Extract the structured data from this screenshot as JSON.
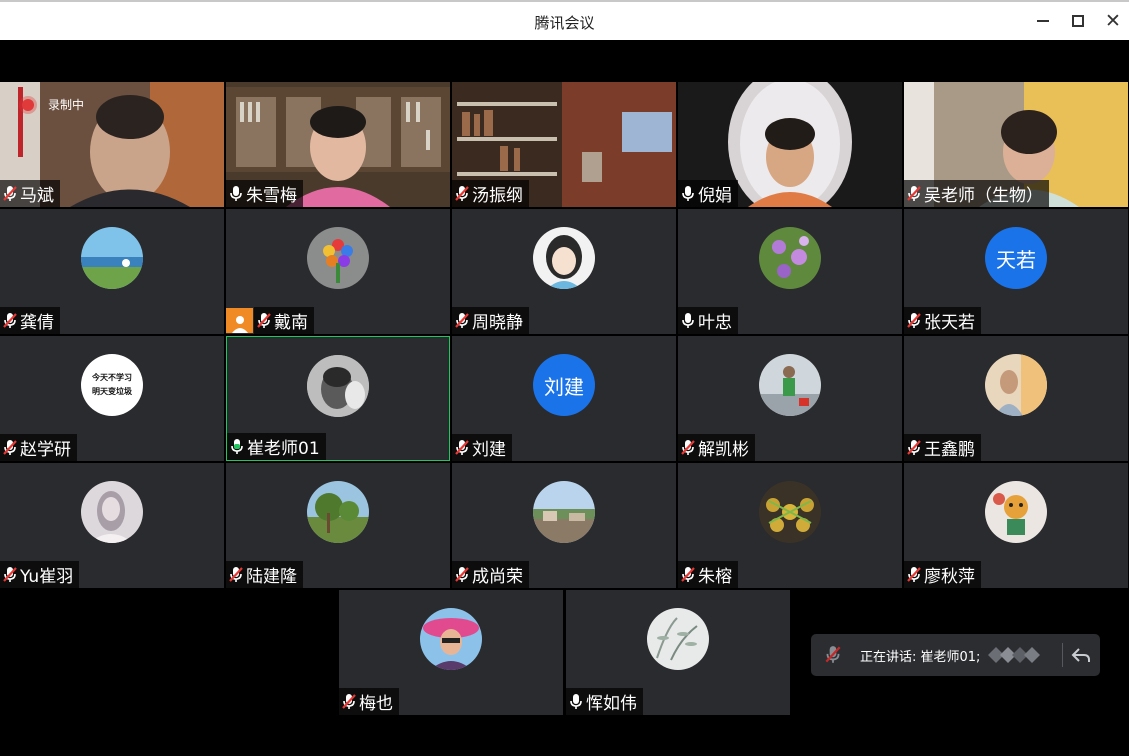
{
  "window": {
    "title": "腾讯会议"
  },
  "recording": {
    "label": "录制中"
  },
  "participants": [
    {
      "name": "马斌",
      "mic": "muted"
    },
    {
      "name": "朱雪梅",
      "mic": "on"
    },
    {
      "name": "汤振纲",
      "mic": "muted"
    },
    {
      "name": "倪娟",
      "mic": "on"
    },
    {
      "name": "吴老师（生物）",
      "mic": "muted"
    },
    {
      "name": "龚倩",
      "mic": "muted"
    },
    {
      "name": "戴南",
      "mic": "muted"
    },
    {
      "name": "周晓静",
      "mic": "muted"
    },
    {
      "name": "叶忠",
      "mic": "on"
    },
    {
      "name": "张天若",
      "mic": "muted",
      "avatar_text": "天若"
    },
    {
      "name": "赵学研",
      "mic": "muted",
      "avatar_line1": "今天不学习",
      "avatar_line2": "明天变垃圾"
    },
    {
      "name": "崔老师01",
      "mic": "speaking"
    },
    {
      "name": "刘建",
      "mic": "muted",
      "avatar_text": "刘建"
    },
    {
      "name": "解凯彬",
      "mic": "muted"
    },
    {
      "name": "王鑫鹏",
      "mic": "muted"
    },
    {
      "name": "Yu崔羽",
      "mic": "muted"
    },
    {
      "name": "陆建隆",
      "mic": "muted"
    },
    {
      "name": "成尚荣",
      "mic": "muted"
    },
    {
      "name": "朱榕",
      "mic": "muted"
    },
    {
      "name": "廖秋萍",
      "mic": "muted"
    },
    {
      "name": "梅也",
      "mic": "muted"
    },
    {
      "name": "恽如伟",
      "mic": "on"
    }
  ],
  "speaking_panel": {
    "label": "正在讲话: 崔老师01;"
  },
  "colors": {
    "tile_bg": "#2a2b2e",
    "active_border": "#22c55e",
    "avatar_blue": "#1a73e8",
    "badge_orange": "#f08a24"
  }
}
